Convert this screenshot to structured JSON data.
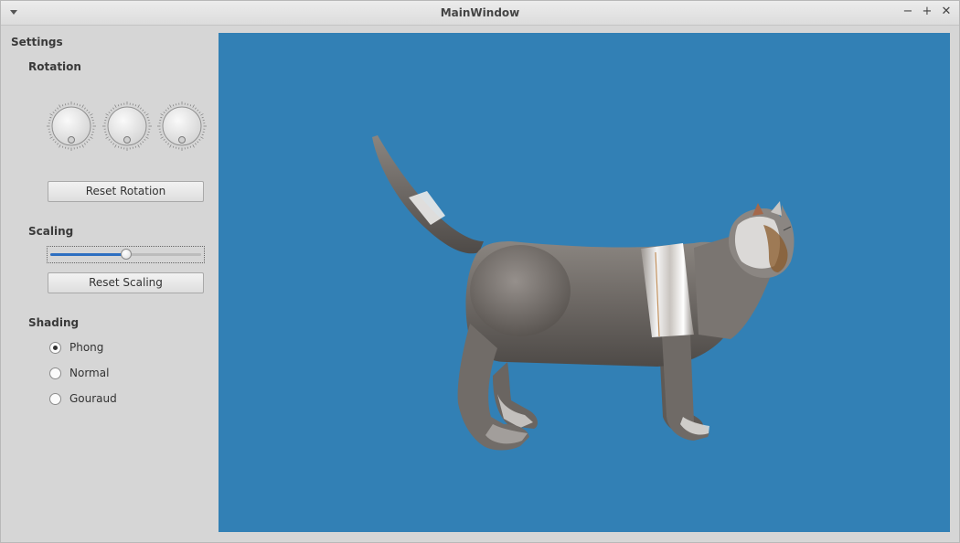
{
  "window": {
    "title": "MainWindow",
    "minimize_glyph": "−",
    "maximize_glyph": "+",
    "close_glyph": "✕"
  },
  "settings": {
    "heading": "Settings",
    "rotation": {
      "heading": "Rotation",
      "dials": [
        {
          "name": "rotation-x-dial",
          "value": 0
        },
        {
          "name": "rotation-y-dial",
          "value": 0
        },
        {
          "name": "rotation-z-dial",
          "value": 0
        }
      ],
      "reset_label": "Reset Rotation"
    },
    "scaling": {
      "heading": "Scaling",
      "slider_value_fraction": 0.5,
      "reset_label": "Reset Scaling"
    },
    "shading": {
      "heading": "Shading",
      "options": [
        {
          "label": "Phong",
          "selected": true
        },
        {
          "label": "Normal",
          "selected": false
        },
        {
          "label": "Gouraud",
          "selected": false
        }
      ]
    }
  },
  "viewport": {
    "background_color": "#3280b5",
    "model": "cat"
  },
  "colors": {
    "accent": "#2e6fc1",
    "window_bg": "#d6d6d6"
  }
}
